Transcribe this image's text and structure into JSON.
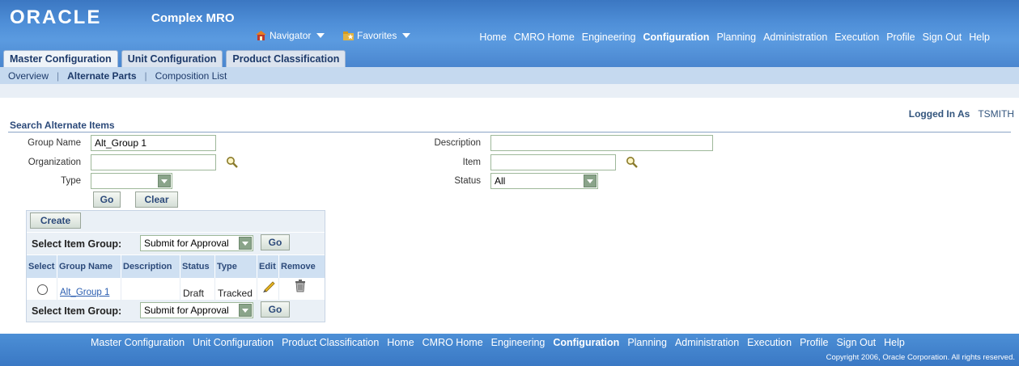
{
  "brand": {
    "logo": "ORACLE",
    "product": "Complex MRO"
  },
  "header_tools": {
    "navigator": "Navigator",
    "favorites": "Favorites"
  },
  "global_links": [
    "Home",
    "CMRO Home",
    "Engineering",
    "Configuration",
    "Planning",
    "Administration",
    "Execution",
    "Profile",
    "Sign Out",
    "Help"
  ],
  "global_active": "Configuration",
  "tabs": [
    {
      "label": "Master Configuration",
      "active": true
    },
    {
      "label": "Unit Configuration",
      "active": false
    },
    {
      "label": "Product Classification",
      "active": false
    }
  ],
  "subtabs": [
    {
      "label": "Overview",
      "active": false
    },
    {
      "label": "Alternate Parts",
      "active": true
    },
    {
      "label": "Composition List",
      "active": false
    }
  ],
  "user": {
    "label": "Logged In As",
    "name": "TSMITH"
  },
  "search": {
    "title": "Search Alternate Items",
    "group_name_label": "Group Name",
    "group_name_value": "Alt_Group 1",
    "organization_label": "Organization",
    "organization_value": "",
    "type_label": "Type",
    "type_value": "",
    "description_label": "Description",
    "description_value": "",
    "item_label": "Item",
    "item_value": "",
    "status_label": "Status",
    "status_value": "All",
    "go_label": "Go",
    "clear_label": "Clear"
  },
  "results": {
    "create_label": "Create",
    "select_group_label": "Select Item Group:",
    "select_group_value": "Submit for Approval",
    "go_label": "Go",
    "columns": [
      "Select",
      "Group Name",
      "Description",
      "Status",
      "Type",
      "Edit",
      "Remove"
    ],
    "rows": [
      {
        "group_name": "Alt_Group 1",
        "description": "",
        "status": "Draft",
        "type": "Tracked"
      }
    ]
  },
  "footer": {
    "links": [
      "Master Configuration",
      "Unit Configuration",
      "Product Classification",
      "Home",
      "CMRO Home",
      "Engineering",
      "Configuration",
      "Planning",
      "Administration",
      "Execution",
      "Profile",
      "Sign Out",
      "Help"
    ],
    "active": "Configuration",
    "copyright": "Copyright 2006, Oracle Corporation. All rights reserved."
  }
}
